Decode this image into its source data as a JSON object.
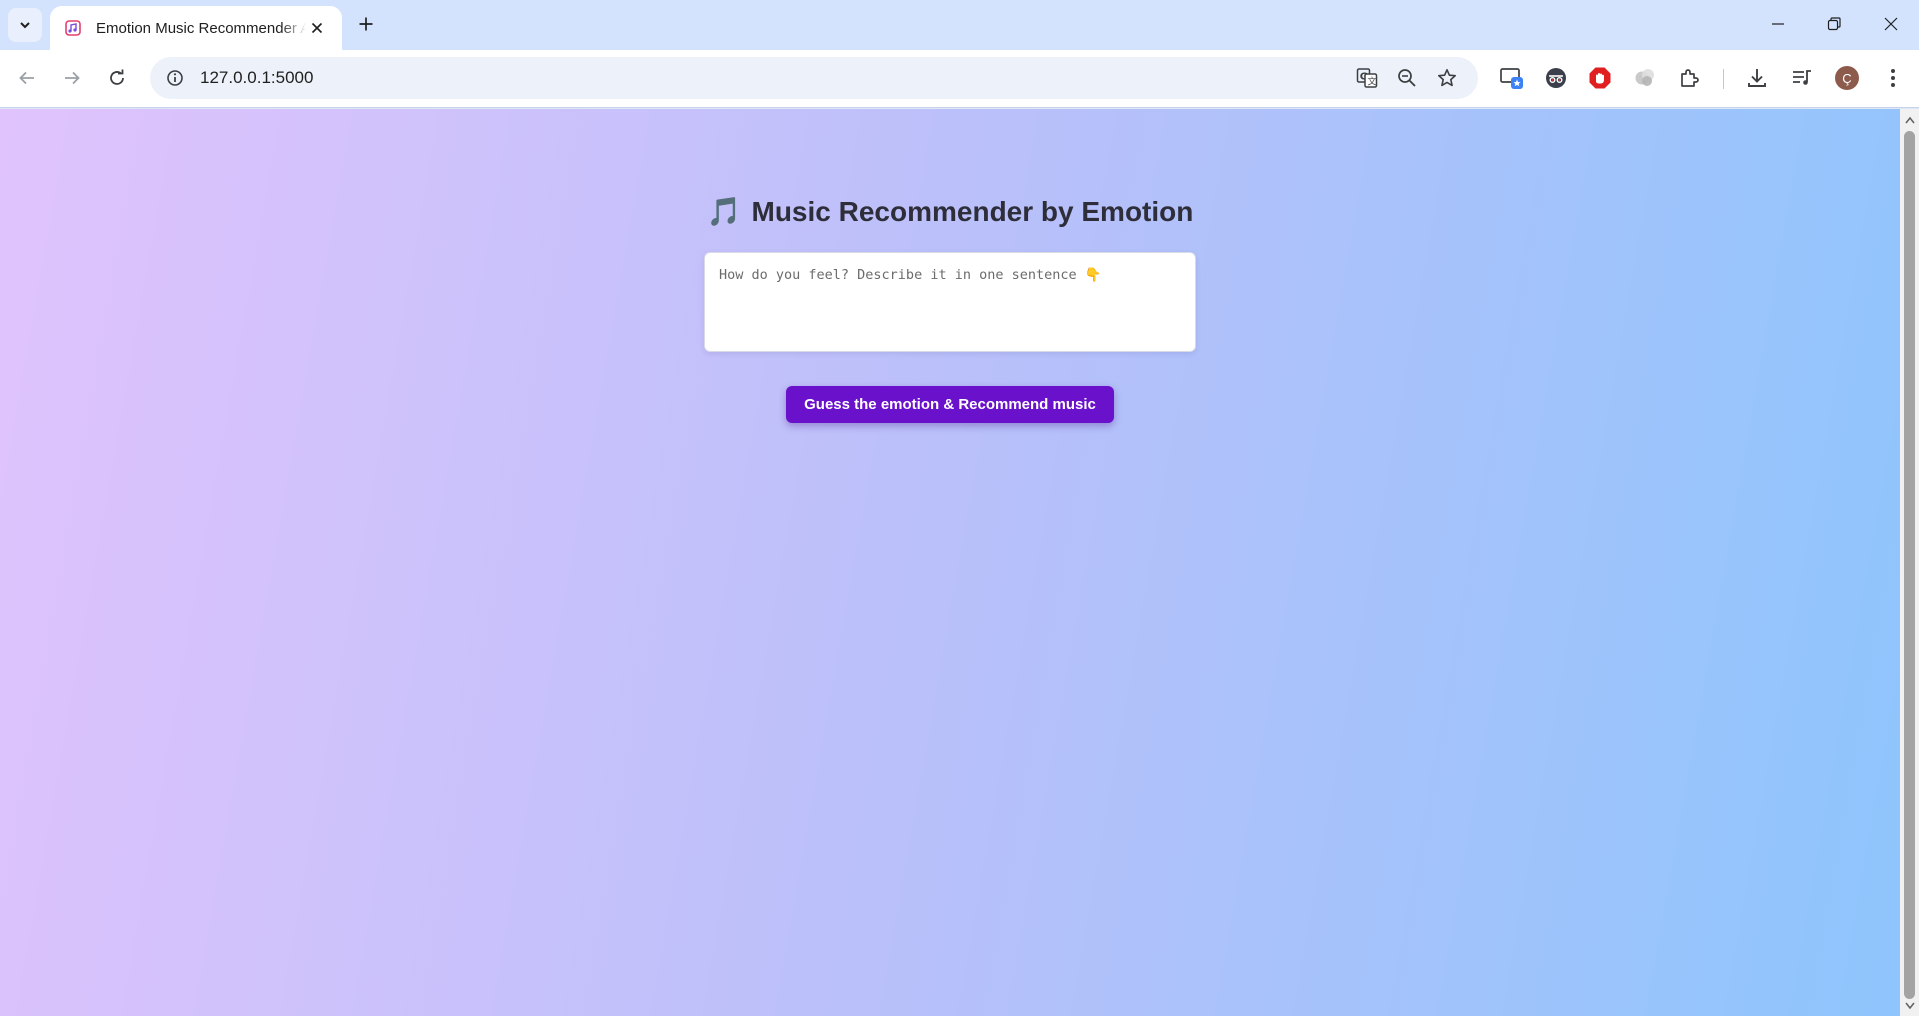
{
  "browser": {
    "tab": {
      "title": "Emotion Music Recommender AI",
      "favicon": "music-note-icon"
    },
    "address_bar": {
      "url": "127.0.0.1:5000"
    },
    "profile_initial": "Ç",
    "icons": [
      "tab-search-icon",
      "new-tab-icon",
      "minimize-icon",
      "restore-icon",
      "close-window-icon",
      "back-icon",
      "forward-icon",
      "reload-icon",
      "site-info-icon",
      "translate-icon",
      "zoom-out-icon",
      "bookmark-star-icon",
      "cast-icon",
      "incognito-extension-icon",
      "adblock-extension-icon",
      "extension-icon",
      "extensions-puzzle-icon",
      "downloads-icon",
      "media-controls-icon",
      "more-menu-icon"
    ]
  },
  "page": {
    "title_emoji": "🎵",
    "title": "Music Recommender by Emotion",
    "input": {
      "placeholder": "How do you feel? Describe it in one sentence 👇",
      "value": ""
    },
    "button_label": "Guess the emotion & Recommend music"
  },
  "colors": {
    "accent": "#6a11cb",
    "gradient_start": "#e0c3fc",
    "gradient_end": "#8ec5fc",
    "tabstrip": "#d3e3fd"
  }
}
